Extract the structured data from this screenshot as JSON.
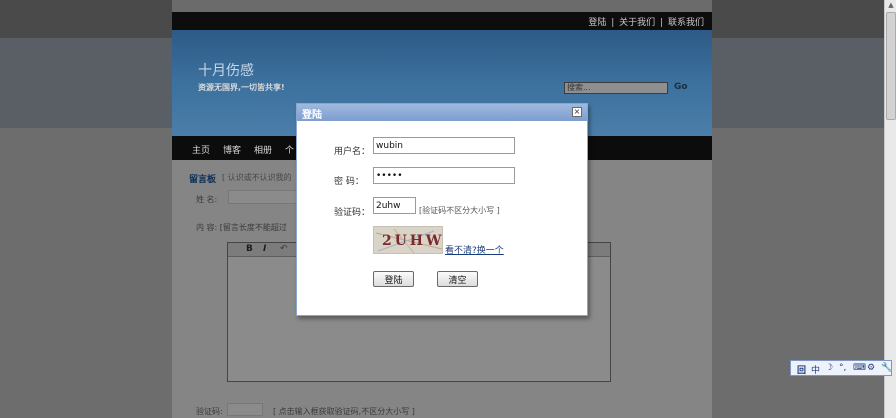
{
  "page": {
    "top_links": [
      "登陆",
      "关于我们",
      "联系我们"
    ],
    "separator": "|",
    "site_title": "十月伤感",
    "site_subtitle": "资源无国界,一切皆共享!",
    "search_placeholder": "搜索...",
    "search_go": "Go",
    "nav": [
      "主页",
      "博客",
      "相册",
      "个"
    ],
    "guestbook_title": "留言板",
    "guestbook_hint": "[ 认识或不认识我的",
    "name_label": "姓    名:",
    "content_label": "内    容: [留言长度不能超过",
    "editor_buttons": {
      "bold": "B",
      "italic": "I",
      "undo": "↶"
    },
    "vcode_label": "验证码:",
    "vcode_hint": "[ 点击输入框获取验证码,不区分大小写 ]"
  },
  "dialog": {
    "title": "登陆",
    "close_glyph": "×",
    "username_label": "用户名：",
    "username_value": "wubin",
    "password_label": "密    码：",
    "password_value": "•••••",
    "captcha_label": "验证码：",
    "captcha_value": "2uhw",
    "captcha_hint": "[验证码不区分大小写 ]",
    "captcha_image_text": "2 U H W",
    "refresh_link": "看不清?换一个",
    "login_button": "登陆",
    "clear_button": "清空"
  },
  "ime": {
    "items": [
      "中",
      "☽",
      "°,",
      "⌨",
      "⚙",
      "🔧"
    ]
  }
}
